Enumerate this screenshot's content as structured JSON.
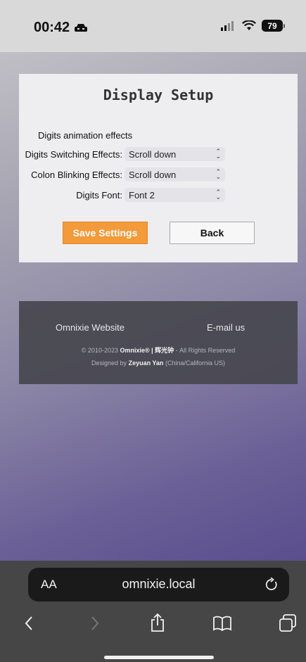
{
  "status_bar": {
    "time": "00:42",
    "battery": "79",
    "icons": [
      "car-icon",
      "signal-icon",
      "wifi-icon",
      "battery-icon"
    ]
  },
  "settings": {
    "title": "Display Setup",
    "section_label": "Digits animation effects",
    "rows": [
      {
        "label": "Digits Switching Effects:",
        "value": "Scroll down"
      },
      {
        "label": "Colon Blinking Effects:",
        "value": "Scroll down"
      },
      {
        "label": "Digits Font:",
        "value": "Font 2"
      }
    ],
    "save_label": "Save Settings",
    "back_label": "Back",
    "save_color": "#f39a3a"
  },
  "footer": {
    "website_link": "Omnixie Website",
    "email_link": "E-mail us",
    "copyright_prefix": "© 2010-2023",
    "brand": "Omnixie® | 辉光钟",
    "copyright_suffix": "- All Rights Reserved",
    "designed_prefix": "Designed by",
    "designer": "Zeyuan Yan",
    "designer_location": "(China/California US)"
  },
  "browser": {
    "text_size_label": "AA",
    "url": "omnixie.local",
    "nav_icons": [
      "back-icon",
      "forward-icon",
      "share-icon",
      "bookmarks-icon",
      "tabs-icon"
    ]
  }
}
